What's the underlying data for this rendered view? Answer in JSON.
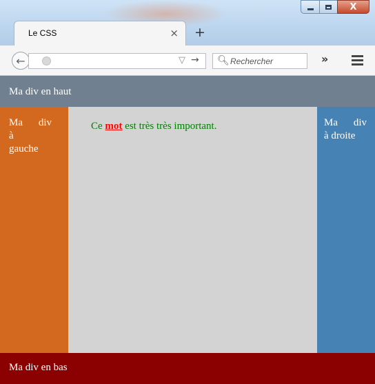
{
  "browser": {
    "tab_title": "Le CSS",
    "tab_close": "×",
    "new_tab": "+",
    "search_placeholder": "Rechercher",
    "overflow": "»",
    "window_close": "X"
  },
  "page": {
    "top_text": "Ma div en haut",
    "left_words": [
      "Ma",
      "div",
      "à",
      "gauche"
    ],
    "center_before": "Ce ",
    "center_important": "mot",
    "center_after": " est très très important.",
    "right_words": [
      "Ma",
      "div",
      "à droite"
    ],
    "bottom_text": "Ma div en bas"
  },
  "colors": {
    "top": "#708090",
    "left": "#d2691e",
    "center": "#d3d3d3",
    "right": "#4682b4",
    "bottom": "#8b0000",
    "center_text": "#008000",
    "important_text": "#ff0000"
  }
}
